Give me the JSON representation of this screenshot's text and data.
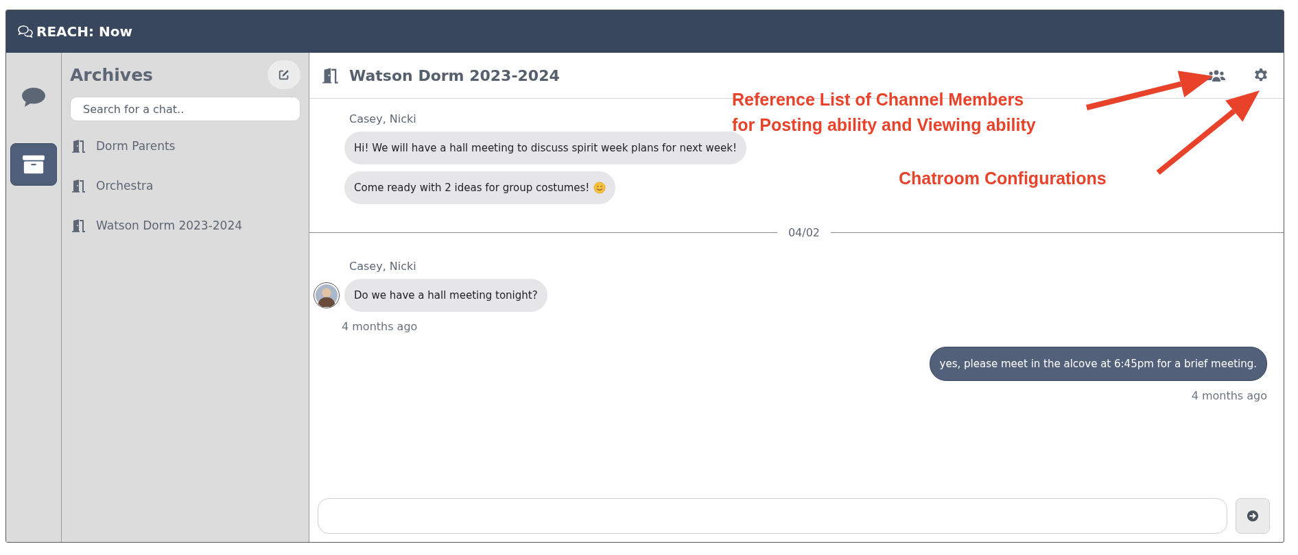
{
  "app": {
    "title": "REACH: Now"
  },
  "rail": [
    {
      "kind": "chats",
      "selected": false
    },
    {
      "kind": "archive",
      "selected": true
    }
  ],
  "sidebar": {
    "title": "Archives",
    "search": {
      "placeholder": "Search for a chat.."
    },
    "items": [
      {
        "label": "Dorm Parents"
      },
      {
        "label": "Orchestra"
      },
      {
        "label": "Watson Dorm 2023-2024"
      }
    ]
  },
  "chat": {
    "title": "Watson Dorm 2023-2024",
    "timeline": [
      {
        "kind": "incoming",
        "sender": "Casey, Nicki",
        "avatar": false,
        "messages": [
          {
            "text": "Hi! We will have a hall meeting to discuss spirit week plans for next week!",
            "emoji": false
          },
          {
            "text": "Come ready with 2 ideas for group costumes!",
            "emoji": true
          }
        ]
      },
      {
        "kind": "divider",
        "label": "04/02"
      },
      {
        "kind": "incoming",
        "sender": "Casey, Nicki",
        "avatar": true,
        "messages": [
          {
            "text": "Do we have a hall meeting tonight?",
            "emoji": false
          }
        ],
        "time": "4 months ago"
      },
      {
        "kind": "outgoing",
        "messages": [
          {
            "text": "yes, please meet in the alcove at 6:45pm for a brief meeting.",
            "emoji": false
          }
        ],
        "time": "4 months ago"
      }
    ]
  },
  "annotations": [
    {
      "text": "Reference List of Channel Members\nfor Posting ability and Viewing ability"
    },
    {
      "text": "Chatroom Configurations"
    }
  ]
}
